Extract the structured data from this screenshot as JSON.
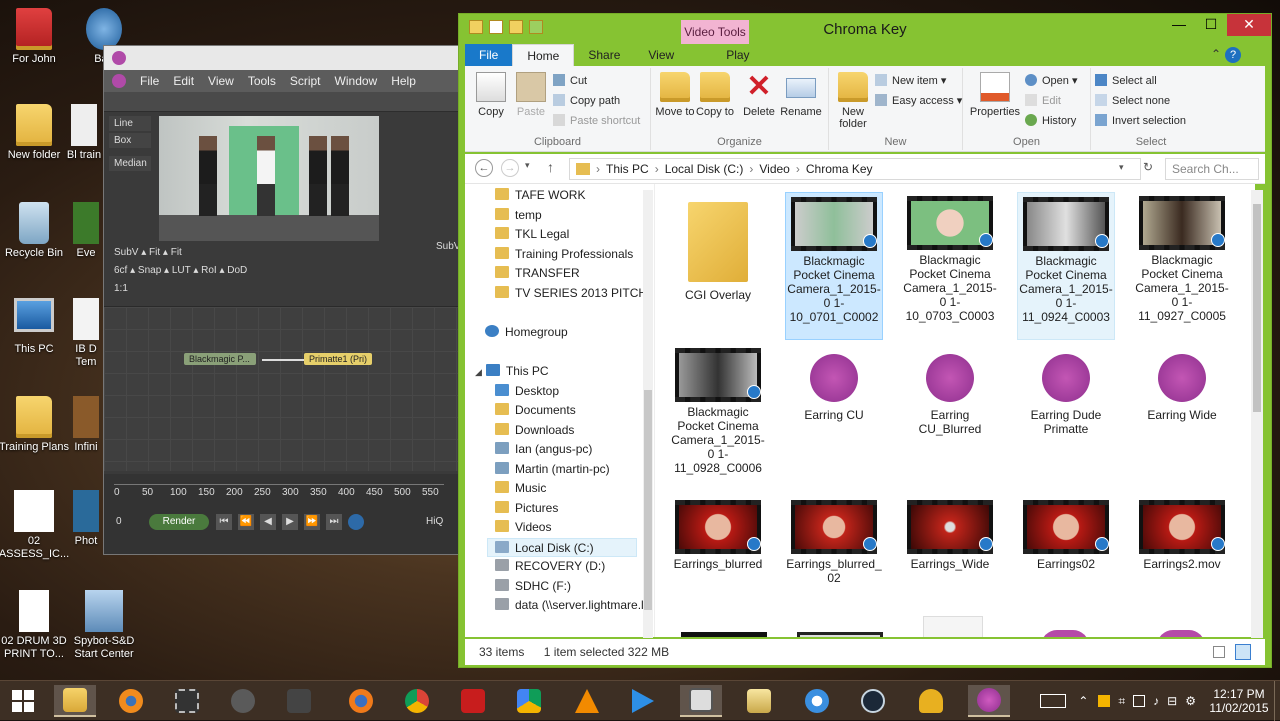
{
  "desktop": {
    "icons": [
      {
        "label": "For John",
        "icon": "folder-icon"
      },
      {
        "label": "Batt",
        "icon": "blender-icon"
      },
      {
        "label": "New folder",
        "icon": "folder-icon"
      },
      {
        "label": "Bl train",
        "icon": "document-icon"
      },
      {
        "label": "Recycle Bin",
        "icon": "recycle-bin-icon"
      },
      {
        "label": "Eve",
        "icon": "app-icon"
      },
      {
        "label": "This PC",
        "icon": "computer-icon"
      },
      {
        "label": "IB D Tem",
        "icon": "document-icon"
      },
      {
        "label": "Training Plans",
        "icon": "folder-icon"
      },
      {
        "label": "Infini",
        "icon": "app-icon"
      },
      {
        "label": "02 ASSESS_IC...",
        "icon": "document-icon"
      },
      {
        "label": "Phot",
        "icon": "app-icon"
      },
      {
        "label": "02 DRUM 3D PRINT TO...",
        "icon": "document-icon"
      },
      {
        "label": "Spybot-S&D Start Center",
        "icon": "spybot-icon"
      }
    ]
  },
  "fusion": {
    "menu": [
      "File",
      "Edit",
      "View",
      "Tools",
      "Script",
      "Window",
      "Help"
    ],
    "side_tools": [
      "Line",
      "Box",
      "Median"
    ],
    "controls_row1": "SubV ▴  Fit ▴ Fit",
    "controls_row2": "6cf ▴ Snap ▴    LUT ▴ RoI ▴ DoD",
    "controls_row3": "1:1",
    "right_controls": "SubV",
    "nodes": [
      {
        "label": "Blackmagic P..."
      },
      {
        "label": "Primatte1 (Pri)"
      }
    ],
    "ruler_ticks": [
      "0",
      "50",
      "100",
      "150",
      "200",
      "250",
      "300",
      "350",
      "400",
      "450",
      "500",
      "550"
    ],
    "frame_field": "0",
    "render_label": "Render",
    "hiq_label": "HiQ"
  },
  "explorer": {
    "title": "Chroma Key",
    "context_tab": "Video Tools",
    "tabs": [
      "File",
      "Home",
      "Share",
      "View",
      "Play"
    ],
    "ribbon": {
      "clipboard": {
        "label": "Clipboard",
        "copy": "Copy",
        "paste": "Paste",
        "cut": "Cut",
        "copy_path": "Copy path",
        "paste_shortcut": "Paste shortcut"
      },
      "organize": {
        "label": "Organize",
        "move_to": "Move to",
        "copy_to": "Copy to",
        "delete": "Delete",
        "rename": "Rename"
      },
      "new": {
        "label": "New",
        "new_folder": "New folder",
        "new_item": "New item",
        "easy_access": "Easy access"
      },
      "open": {
        "label": "Open",
        "properties": "Properties",
        "open": "Open",
        "edit": "Edit",
        "history": "History"
      },
      "select": {
        "label": "Select",
        "select_all": "Select all",
        "select_none": "Select none",
        "invert": "Invert selection"
      }
    },
    "address": {
      "crumbs": [
        "This PC",
        "Local Disk (C:)",
        "Video",
        "Chroma Key"
      ]
    },
    "search_placeholder": "Search Ch...",
    "nav_items": [
      {
        "label": "TAFE WORK",
        "icon": "folder-icon"
      },
      {
        "label": "temp",
        "icon": "folder-icon"
      },
      {
        "label": "TKL Legal",
        "icon": "folder-icon"
      },
      {
        "label": "Training Professionals",
        "icon": "folder-icon"
      },
      {
        "label": "TRANSFER",
        "icon": "folder-icon"
      },
      {
        "label": "TV SERIES 2013 PITCH",
        "icon": "folder-icon"
      },
      {
        "label": "Homegroup",
        "icon": "homegroup-icon"
      },
      {
        "label": "This PC",
        "icon": "computer-icon"
      },
      {
        "label": "Desktop",
        "icon": "folder-icon"
      },
      {
        "label": "Documents",
        "icon": "folder-icon"
      },
      {
        "label": "Downloads",
        "icon": "folder-icon"
      },
      {
        "label": "Ian (angus-pc)",
        "icon": "network-computer-icon"
      },
      {
        "label": "Martin (martin-pc)",
        "icon": "network-computer-icon"
      },
      {
        "label": "Music",
        "icon": "folder-icon"
      },
      {
        "label": "Pictures",
        "icon": "folder-icon"
      },
      {
        "label": "Videos",
        "icon": "folder-icon"
      },
      {
        "label": "Local Disk (C:)",
        "icon": "drive-icon"
      },
      {
        "label": "RECOVERY (D:)",
        "icon": "drive-icon"
      },
      {
        "label": "SDHC (F:)",
        "icon": "drive-icon"
      },
      {
        "label": "data (\\\\server.lightmare.lo",
        "icon": "network-drive-icon"
      }
    ],
    "files": [
      {
        "name": "CGI Overlay",
        "kind": "folder"
      },
      {
        "name": "Blackmagic Pocket Cinema Camera_1_2015-0 1-10_0701_C0002",
        "kind": "video",
        "state": "selected"
      },
      {
        "name": "Blackmagic Pocket Cinema Camera_1_2015-0 1-10_0703_C0003",
        "kind": "video"
      },
      {
        "name": "Blackmagic Pocket Cinema Camera_1_2015-0 1-11_0924_C0003",
        "kind": "video",
        "state": "hover"
      },
      {
        "name": "Blackmagic Pocket Cinema Camera_1_2015-0 1-11_0927_C0005",
        "kind": "video"
      },
      {
        "name": "Blackmagic Pocket Cinema Camera_1_2015-0 1-11_0928_C0006",
        "kind": "video"
      },
      {
        "name": "Earring CU",
        "kind": "fusion"
      },
      {
        "name": "Earring CU_Blurred",
        "kind": "fusion"
      },
      {
        "name": "Earring Dude Primatte",
        "kind": "fusion"
      },
      {
        "name": "Earring Wide",
        "kind": "fusion"
      },
      {
        "name": "Earrings_blurred",
        "kind": "video-red"
      },
      {
        "name": "Earrings_blurred_ 02",
        "kind": "video-red"
      },
      {
        "name": "Earrings_Wide",
        "kind": "video-red"
      },
      {
        "name": "Earrings02",
        "kind": "video-red"
      },
      {
        "name": "Earrings2.mov",
        "kind": "video-red"
      }
    ],
    "status": {
      "count": "33 items",
      "selection": "1 item selected  322 MB"
    }
  },
  "taskbar": {
    "apps": [
      "start-icon",
      "file-explorer-icon",
      "blender-icon",
      "film-icon",
      "app-icon",
      "gear-mask-icon",
      "firefox-icon",
      "chrome-icon",
      "acrobat-icon",
      "drive-icon",
      "vlc-icon",
      "play-icon",
      "camera-icon",
      "email-icon",
      "itunes-icon",
      "steam-icon",
      "headset-icon",
      "fusion-icon"
    ],
    "time": "12:17 PM",
    "date": "11/02/2015"
  }
}
